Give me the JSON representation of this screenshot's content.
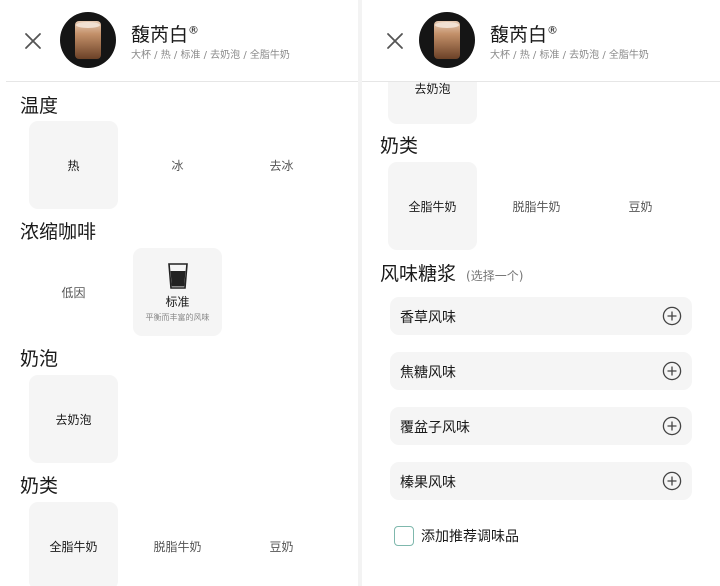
{
  "left": {
    "header": {
      "title": "馥芮白",
      "trademark": "®",
      "subtitle": "大杯 / 热 / 标准 / 去奶泡 / 全脂牛奶"
    },
    "temperature": {
      "title": "温度",
      "options": [
        "热",
        "冰",
        "去冰"
      ],
      "selected": "热"
    },
    "espresso": {
      "title": "浓缩咖啡",
      "options": [
        "低因",
        "标准"
      ],
      "standard_desc": "平衡而丰富的风味",
      "selected": "标准"
    },
    "foam": {
      "title": "奶泡",
      "options": [
        "去奶泡"
      ],
      "selected": "去奶泡"
    },
    "milk": {
      "title": "奶类",
      "options": [
        "全脂牛奶",
        "脱脂牛奶",
        "豆奶"
      ],
      "selected": "全脂牛奶"
    }
  },
  "right": {
    "header": {
      "title": "馥芮白",
      "trademark": "®",
      "subtitle": "大杯 / 热 / 标准 / 去奶泡 / 全脂牛奶"
    },
    "cut_option": "去奶泡",
    "milk": {
      "title": "奶类",
      "options": [
        "全脂牛奶",
        "脱脂牛奶",
        "豆奶"
      ],
      "selected": "全脂牛奶"
    },
    "syrup": {
      "title": "风味糖浆",
      "hint": "(选择一个)",
      "items": [
        "香草风味",
        "焦糖风味",
        "覆盆子风味",
        "榛果风味"
      ]
    },
    "recommend_label": "添加推荐调味品"
  },
  "icons": {
    "close": "close-icon",
    "add": "plus-circle-icon",
    "glass": "espresso-glass-icon"
  },
  "colors": {
    "selected_bg": "#f5f5f5",
    "checkbox_border": "#7fb8ad",
    "text_secondary": "#8a8a8a"
  }
}
